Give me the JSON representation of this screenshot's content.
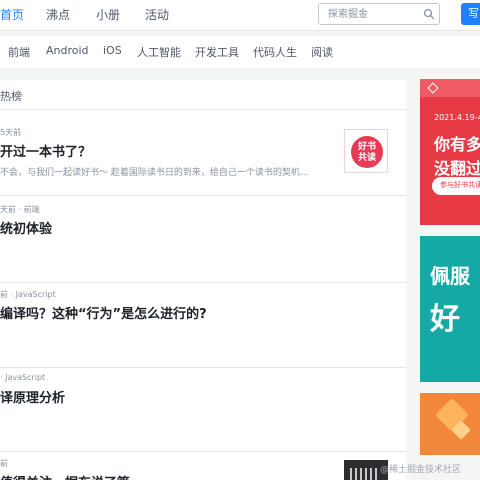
{
  "colors": {
    "accent": "#1e80ff",
    "ad1": "#e83a45",
    "ad2": "#14a9a4",
    "ad3": "#f0873a"
  },
  "header": {
    "nav": [
      "首页",
      "沸点",
      "小册",
      "活动"
    ],
    "search_placeholder": "探索掘金",
    "search_icon": "search-icon",
    "write_label": "写"
  },
  "categories": [
    "前端",
    "Android",
    "iOS",
    "人工智能",
    "开发工具",
    "代码人生",
    "阅读"
  ],
  "feed": {
    "title": "热榜",
    "articles": [
      {
        "meta": "5天前",
        "title": "开过一本书了？",
        "abstract": "不会，与我们一起读好书～ 趁着国际读书日的到来，给自己一个读书的契机..."
      },
      {
        "meta": "天前 · 前端",
        "title": "统初体验",
        "abstract": ""
      },
      {
        "meta": "前 · JavaScript",
        "title": "编译吗？这种“行为”是怎么进行的?",
        "abstract": ""
      },
      {
        "meta": "· JavaScript",
        "title": "译原理分析",
        "abstract": ""
      },
      {
        "meta": "前",
        "title": "值得关注，据东说了篇",
        "abstract": ""
      }
    ],
    "book_thumb": {
      "line1": "好书",
      "line2": "共读"
    }
  },
  "ads": {
    "ad1": {
      "date": "2021.4.19-4.",
      "line1": "你有多",
      "line2": "没翻过",
      "button": "参与好书共读"
    },
    "ad2": {
      "line1": "佩服",
      "line2": "好"
    }
  },
  "watermark": "@稀土掘金技术社区"
}
